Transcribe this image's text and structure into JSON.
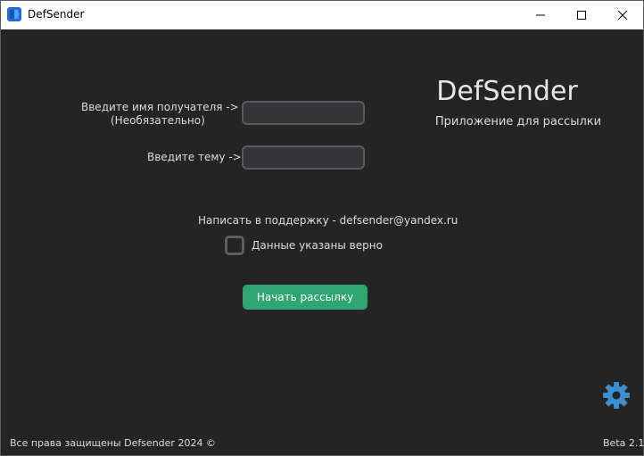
{
  "window": {
    "title": "DefSender"
  },
  "form": {
    "recipient_label": "Введите имя получателя ->",
    "recipient_optional": "(Необязательно)",
    "recipient_value": "",
    "subject_label": "Введите тему ->",
    "subject_value": ""
  },
  "brand": {
    "title": "DefSender",
    "subtitle": "Приложение для рассылки"
  },
  "support": {
    "text": "Написать в поддержку - defsender@yandex.ru"
  },
  "confirm": {
    "label": "Данные указаны верно",
    "checked": false
  },
  "actions": {
    "start_label": "Начать рассылку"
  },
  "footer": {
    "copyright": "Все права защищены Defsender 2024 ©",
    "version": "Beta 2.1"
  },
  "colors": {
    "background": "#242424",
    "accent": "#2fa572",
    "entry_bg": "#343638",
    "entry_border": "#565b5e",
    "gear": "#3b8ed0"
  },
  "icons": {
    "app": "app-icon",
    "minimize": "minimize-icon",
    "maximize": "maximize-icon",
    "close": "close-icon",
    "settings": "gear-icon"
  }
}
